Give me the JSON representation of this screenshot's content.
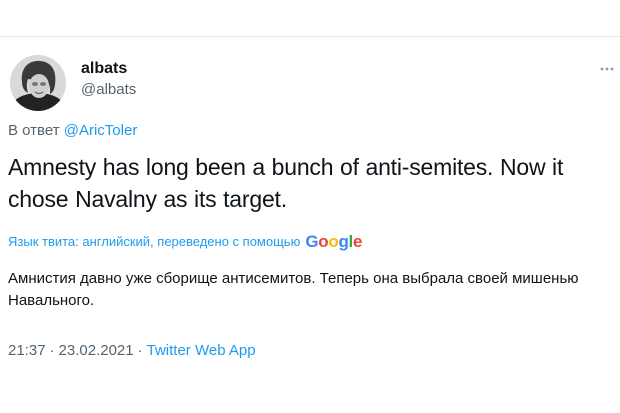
{
  "tweet": {
    "display_name": "albats",
    "handle": "@albats",
    "avatar_icon": "user-avatar-photo",
    "more_icon": "more-dots-icon",
    "reply": {
      "prefix": "В ответ",
      "to": "@AricToler"
    },
    "text": "Amnesty has long been a bunch of anti-semites. Now it chose Navalny as its target.",
    "translation": {
      "label": "Язык твита: английский, переведено с помощью",
      "provider": "Google",
      "text": "Амнистия давно уже сборище антисемитов. Теперь она выбрала своей мишенью Навального."
    },
    "time": "21:37",
    "date": "23.02.2021",
    "source": "Twitter Web App"
  },
  "colors": {
    "accent": "#1d9bf0",
    "secondary_text": "#536471",
    "primary_text": "#0f1419",
    "google_blue": "#4285F4",
    "google_red": "#EA4335",
    "google_yellow": "#FBBC05",
    "google_green": "#34A853"
  }
}
